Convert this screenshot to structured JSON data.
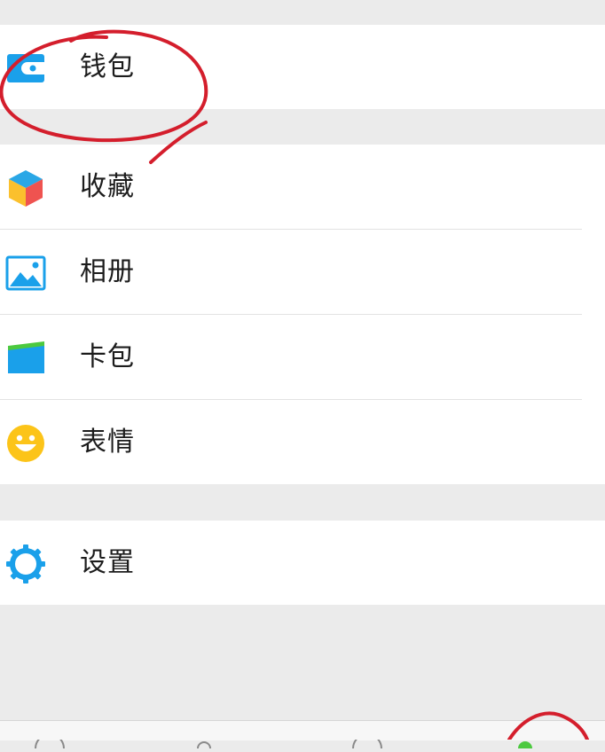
{
  "menu": {
    "wallet": {
      "label": "钱包",
      "icon": "wallet-icon"
    },
    "items": [
      {
        "label": "收藏",
        "icon": "favorites-cube-icon"
      },
      {
        "label": "相册",
        "icon": "album-picture-icon"
      },
      {
        "label": "卡包",
        "icon": "card-wallet-icon"
      },
      {
        "label": "表情",
        "icon": "emoji-smile-icon"
      }
    ],
    "settings": {
      "label": "设置",
      "icon": "gear-icon"
    }
  },
  "colors": {
    "background": "#ebebeb",
    "wallet_blue": "#1aa0ea",
    "annotation_red": "#d41e2c",
    "tab_active_green": "#4cc93f"
  }
}
